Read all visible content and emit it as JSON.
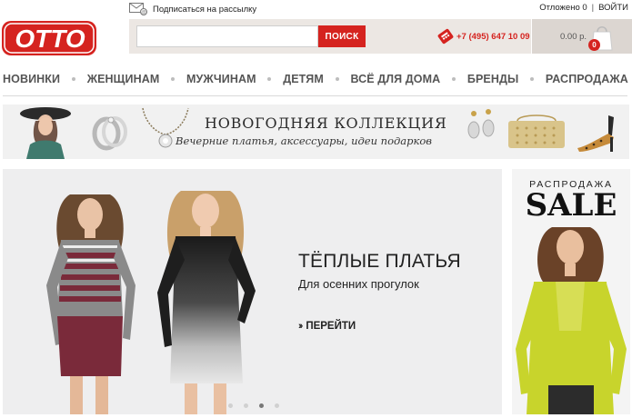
{
  "header": {
    "logo_text": "OTTO",
    "newsletter_label": "Подписаться на рассылку",
    "saved_label": "Отложено 0",
    "login_label": "ВОЙТИ",
    "separator": "|",
    "search": {
      "placeholder": "",
      "button_label": "ПОИСК"
    },
    "phone": "+7 (495) 647 10 09",
    "cart": {
      "price": "0.00 р.",
      "count": "0"
    }
  },
  "nav": {
    "items": [
      {
        "label": "НОВИНКИ"
      },
      {
        "label": "ЖЕНЩИНАМ"
      },
      {
        "label": "МУЖЧИНАМ"
      },
      {
        "label": "ДЕТЯМ"
      },
      {
        "label": "ВСЁ ДЛЯ ДОМА"
      },
      {
        "label": "БРЕНДЫ"
      },
      {
        "label": "РАСПРОДАЖА"
      }
    ]
  },
  "collection_banner": {
    "title": "НОВОГОДНЯЯ КОЛЛЕКЦИЯ",
    "subtitle": "Вечерние платья, аксессуары, идеи подарков"
  },
  "hero": {
    "title": "ТЁПЛЫЕ ПЛАТЬЯ",
    "subtitle": "Для осенних прогулок",
    "cta_label": "ПЕРЕЙТИ",
    "slides_total": 4,
    "active_slide": 3
  },
  "sale_panel": {
    "small_label": "РАСПРОДАЖА",
    "big_label": "SALE"
  },
  "colors": {
    "brand_red": "#d5231f",
    "search_bar_bg": "#ece7e3",
    "cart_bg": "#dcd6d1",
    "nav_text": "#555555",
    "top_dress_band": "#7a2a3a",
    "cardigan_lime": "#c8d42c"
  }
}
